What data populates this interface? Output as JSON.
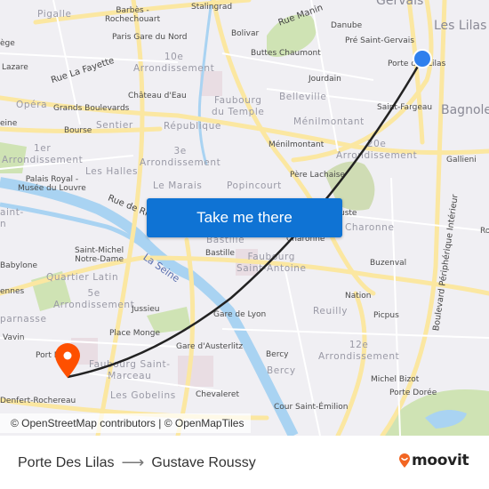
{
  "map": {
    "districts": [
      {
        "id": "pigalle",
        "text": "Pigalle"
      },
      {
        "id": "10e",
        "text": "10e\nArrondissement"
      },
      {
        "id": "faubourg-temple",
        "text": "Faubourg\ndu Temple"
      },
      {
        "id": "belleville",
        "text": "Belleville"
      },
      {
        "id": "menilmontant",
        "text": "Ménilmontant"
      },
      {
        "id": "opera",
        "text": "Opéra"
      },
      {
        "id": "sentier",
        "text": "Sentier"
      },
      {
        "id": "republique",
        "text": "République"
      },
      {
        "id": "1er",
        "text": "1er\nArrondissement"
      },
      {
        "id": "3e",
        "text": "3e\nArrondissement"
      },
      {
        "id": "20e",
        "text": "20e\nArrondissement"
      },
      {
        "id": "les-halles",
        "text": "Les Halles"
      },
      {
        "id": "le-marais",
        "text": "Le Marais"
      },
      {
        "id": "popincourt",
        "text": "Popincourt"
      },
      {
        "id": "charonne",
        "text": "Charonne"
      },
      {
        "id": "bastille-d",
        "text": "Bastille"
      },
      {
        "id": "faubourg-st-antoine",
        "text": "Faubourg\nSaint-Antoine"
      },
      {
        "id": "quartier-latin",
        "text": "Quartier Latin"
      },
      {
        "id": "5e",
        "text": "5e\nArrondissement"
      },
      {
        "id": "montparnasse",
        "text": "parnasse"
      },
      {
        "id": "reuilly",
        "text": "Reuilly"
      },
      {
        "id": "12e",
        "text": "12e\nArrondissement"
      },
      {
        "id": "bercy-d",
        "text": "Bercy"
      },
      {
        "id": "faubourg-st-marceau",
        "text": "Faubourg Saint-\nMarceau"
      },
      {
        "id": "les-gobelins",
        "text": "Les Gobelins"
      },
      {
        "id": "saint-germain",
        "text": "aint-\nn"
      }
    ],
    "cities": [
      {
        "id": "gervais",
        "text": "Gervais"
      },
      {
        "id": "les-lilas",
        "text": "Les Lilas"
      },
      {
        "id": "bagnolet",
        "text": "Bagnole"
      }
    ],
    "stations": [
      {
        "id": "barbes",
        "text": "Barbès -\nRochechouart"
      },
      {
        "id": "stalingrad",
        "text": "Stalingrad"
      },
      {
        "id": "gare-du-nord",
        "text": "Paris Gare du Nord"
      },
      {
        "id": "bolivar",
        "text": "Bolivar"
      },
      {
        "id": "danube",
        "text": "Danube"
      },
      {
        "id": "pre-st-gervais",
        "text": "Pré Saint-Gervais"
      },
      {
        "id": "buttes-chaumont",
        "text": "Buttes Chaumont"
      },
      {
        "id": "porte-des-lilas",
        "text": "Porte des Lilas"
      },
      {
        "id": "lazare",
        "text": "Lazare"
      },
      {
        "id": "liege",
        "text": "ège"
      },
      {
        "id": "jourdain",
        "text": "Jourdain"
      },
      {
        "id": "chateau-deau",
        "text": "Château d'Eau"
      },
      {
        "id": "grands-boulevards",
        "text": "Grands Boulevards"
      },
      {
        "id": "saint-fargeau",
        "text": "Saint-Fargeau"
      },
      {
        "id": "madeleine",
        "text": "eine"
      },
      {
        "id": "bourse",
        "text": "Bourse"
      },
      {
        "id": "menilmontant-st",
        "text": "Ménilmontant"
      },
      {
        "id": "gallieni",
        "text": "Gallieni"
      },
      {
        "id": "palais-royal",
        "text": "Palais Royal -\nMusée du Louvre"
      },
      {
        "id": "pere-lachaise",
        "text": "Père Lachaise"
      },
      {
        "id": "alexandre-dumas",
        "text": "uste"
      },
      {
        "id": "charonne-st",
        "text": "Charonne"
      },
      {
        "id": "bastille",
        "text": "Bastille"
      },
      {
        "id": "saint-michel",
        "text": "Saint-Michel\nNotre-Dame"
      },
      {
        "id": "babylone",
        "text": "Babylone"
      },
      {
        "id": "buzenval",
        "text": "Buzenval"
      },
      {
        "id": "rennes",
        "text": "ennes"
      },
      {
        "id": "nation",
        "text": "Nation"
      },
      {
        "id": "jussieu",
        "text": "Jussieu"
      },
      {
        "id": "picpus",
        "text": "Picpus"
      },
      {
        "id": "gare-de-lyon",
        "text": "Gare de Lyon"
      },
      {
        "id": "place-monge",
        "text": "Place Monge"
      },
      {
        "id": "vavin",
        "text": "Vavin"
      },
      {
        "id": "gare-austerlitz",
        "text": "Gare d'Austerlitz"
      },
      {
        "id": "bercy",
        "text": "Bercy"
      },
      {
        "id": "port-royal",
        "text": "Port R"
      },
      {
        "id": "michel-bizot",
        "text": "Michel Bizot"
      },
      {
        "id": "porte-doree",
        "text": "Porte Dorée"
      },
      {
        "id": "chevaleret",
        "text": "Chevaleret"
      },
      {
        "id": "denfert",
        "text": "Denfert-Rochereau"
      },
      {
        "id": "cour-st-emilion",
        "text": "Cour Saint-Émilion"
      },
      {
        "id": "ro",
        "text": "Ro"
      }
    ],
    "streets": [
      {
        "id": "rue-manin",
        "text": "Rue Manin"
      },
      {
        "id": "rue-la-fayette",
        "text": "Rue La Fayette"
      },
      {
        "id": "rue-de-rivoli",
        "text": "Rue de Ri"
      },
      {
        "id": "bd-peripherique",
        "text": "Boulevard Périphérique Intérieur"
      }
    ],
    "river": {
      "text": "La Seine"
    },
    "origin": {
      "name": "Porte Des Lilas",
      "color": "#2f80ed"
    },
    "destination": {
      "name": "Gustave Roussy",
      "color": "#fe5000"
    },
    "route_color": "#222222",
    "attribution": "© OpenStreetMap contributors | © OpenMapTiles"
  },
  "cta": {
    "label": "Take me there"
  },
  "footer": {
    "origin": "Porte Des Lilas",
    "arrow": "⟶",
    "destination": "Gustave Roussy",
    "logo_text": "moovit",
    "logo_color": "#f26522"
  }
}
